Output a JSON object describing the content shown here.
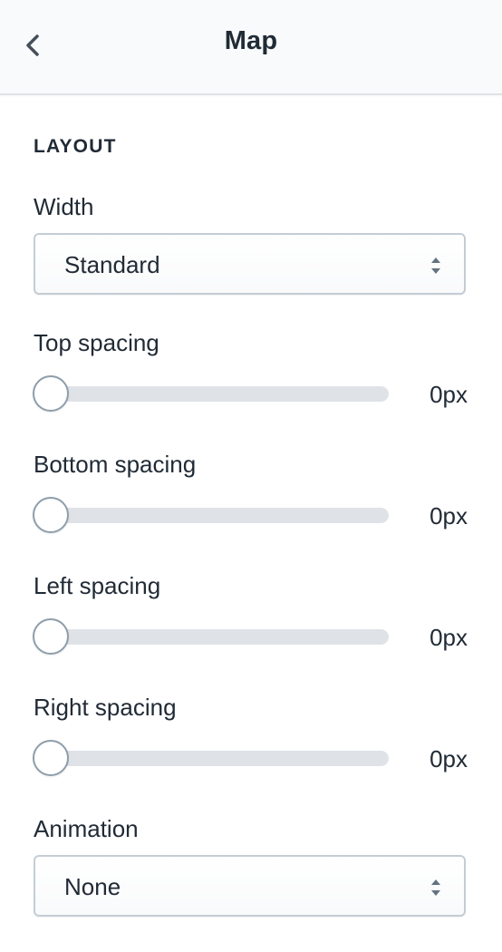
{
  "header": {
    "back_icon": "chevron-left-icon",
    "title": "Map"
  },
  "layout": {
    "heading": "LAYOUT",
    "width": {
      "label": "Width",
      "value": "Standard",
      "icon": "select-arrows-icon"
    },
    "sliders": [
      {
        "label": "Top spacing",
        "value": "0px",
        "level": 0
      },
      {
        "label": "Bottom spacing",
        "value": "0px",
        "level": 0
      },
      {
        "label": "Left spacing",
        "value": "0px",
        "level": 0
      },
      {
        "label": "Right spacing",
        "value": "0px",
        "level": 0
      }
    ],
    "animation": {
      "label": "Animation",
      "value": "None",
      "icon": "select-arrows-icon"
    }
  },
  "colors": {
    "header_bg": "#f9fafb",
    "text": "#212b36",
    "track": "#dfe3e8",
    "thumb_border": "#8e9eab",
    "select_border": "#c4cdd5"
  }
}
